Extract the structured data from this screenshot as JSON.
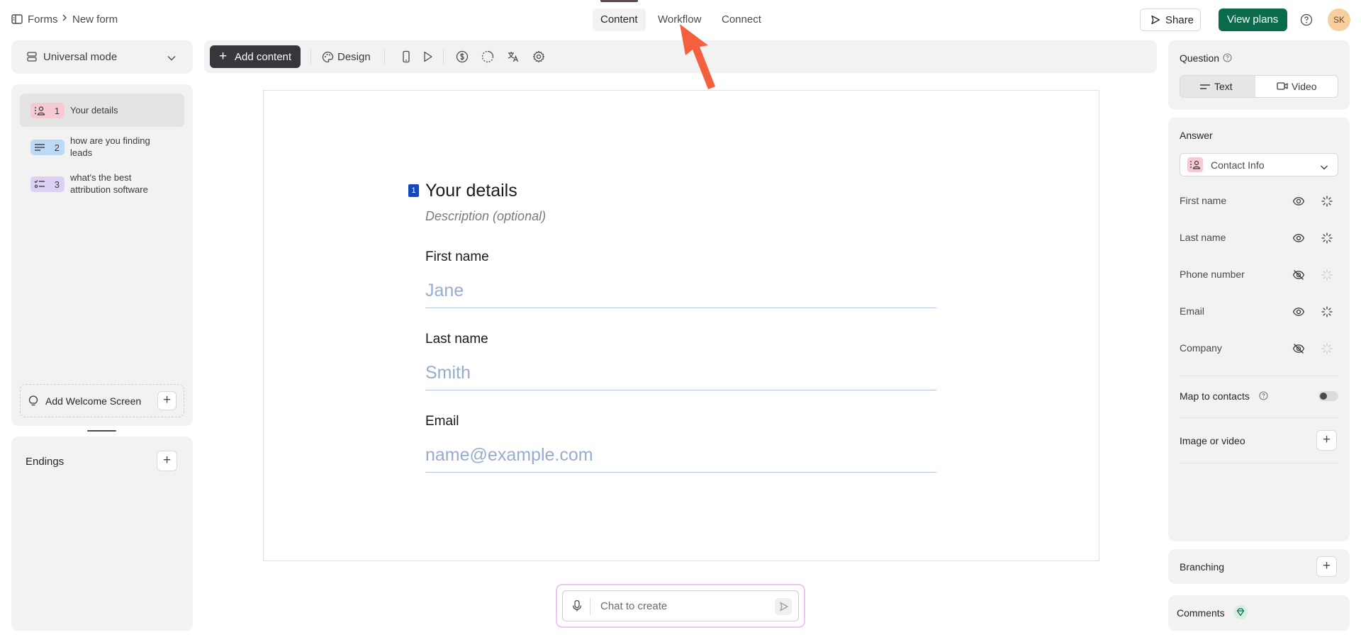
{
  "header": {
    "breadcrumb": [
      "Forms",
      "New form"
    ],
    "tabs": [
      {
        "label": "Content",
        "active": true
      },
      {
        "label": "Workflow",
        "active": false
      },
      {
        "label": "Connect",
        "active": false
      }
    ],
    "share_label": "Share",
    "view_plans_label": "View plans",
    "avatar_initials": "SK"
  },
  "sidebar": {
    "mode_label": "Universal mode",
    "questions": [
      {
        "number": "1",
        "label": "Your details",
        "icon": "contact-info-icon",
        "color": "#f7c9d2"
      },
      {
        "number": "2",
        "label": "how are you finding leads",
        "icon": "text-lines-icon",
        "color": "#bcd9f5"
      },
      {
        "number": "3",
        "label": "what's the best attribution software",
        "icon": "list-icon",
        "color": "#dcd1f5"
      }
    ],
    "welcome_label": "Add Welcome Screen",
    "endings_label": "Endings"
  },
  "toolbar": {
    "add_content_label": "Add content",
    "design_label": "Design"
  },
  "canvas": {
    "question_number": "1",
    "title": "Your details",
    "description_placeholder": "Description (optional)",
    "fields": [
      {
        "label": "First name",
        "placeholder": "Jane"
      },
      {
        "label": "Last name",
        "placeholder": "Smith"
      },
      {
        "label": "Email",
        "placeholder": "name@example.com"
      }
    ]
  },
  "chat": {
    "placeholder": "Chat to create"
  },
  "right_panel": {
    "question_label": "Question",
    "question_types": [
      {
        "label": "Text",
        "active": true
      },
      {
        "label": "Video",
        "active": false
      }
    ],
    "answer_label": "Answer",
    "answer_type": "Contact Info",
    "answer_fields": [
      {
        "label": "First name",
        "visible": true,
        "required_enabled": true
      },
      {
        "label": "Last name",
        "visible": true,
        "required_enabled": true
      },
      {
        "label": "Phone number",
        "visible": false,
        "required_enabled": false
      },
      {
        "label": "Email",
        "visible": true,
        "required_enabled": true
      },
      {
        "label": "Company",
        "visible": false,
        "required_enabled": false
      }
    ],
    "map_to_contacts_label": "Map to contacts",
    "map_to_contacts_on": false,
    "image_video_label": "Image or video",
    "branching_label": "Branching",
    "comments_label": "Comments"
  },
  "colors": {
    "accent_green": "#0b6c4d",
    "question_badge_blue": "#1747b8",
    "pointer_arrow": "#f4603e"
  }
}
